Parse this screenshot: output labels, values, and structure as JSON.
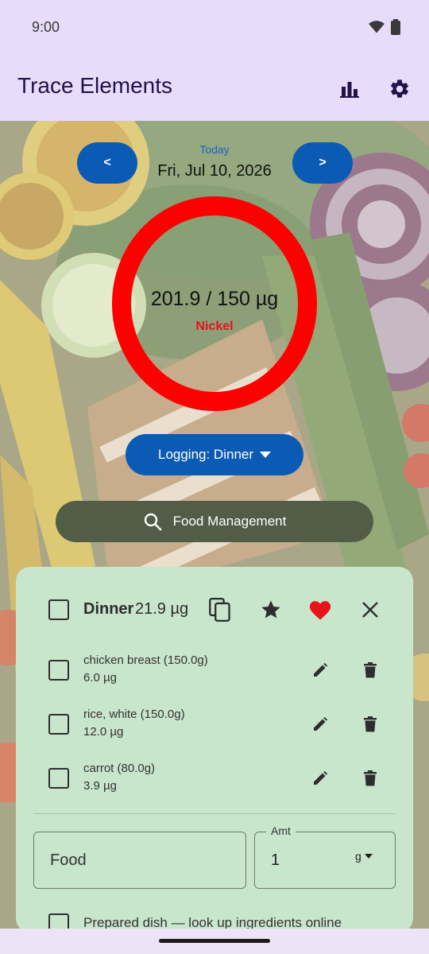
{
  "status": {
    "time": "9:00"
  },
  "app": {
    "title": "Trace Elements",
    "chart_icon": "bar-chart-icon",
    "settings_icon": "gear-icon"
  },
  "date_nav": {
    "prev_label": "<",
    "next_label": ">",
    "today_label": "Today",
    "date": "Fri, Jul 10, 2026"
  },
  "summary": {
    "value_text": "201.9 / 150 µg",
    "element": "Nickel",
    "ring_color": "#ff0000",
    "progress": 1.346
  },
  "logging": {
    "label": "Logging: Dinner"
  },
  "food_management": {
    "label": "Food Management"
  },
  "meal": {
    "title": "Dinner",
    "amount": "21.9 µg",
    "items": [
      {
        "name": "chicken breast (150.0g)",
        "value": "6.0 µg"
      },
      {
        "name": "rice, white (150.0g)",
        "value": "12.0 µg"
      },
      {
        "name": "carrot (80.0g)",
        "value": "3.9 µg"
      }
    ]
  },
  "form": {
    "food_placeholder": "Food",
    "amt_label": "Amt",
    "amt_value": "1",
    "amt_unit": "g",
    "prepared_label": "Prepared dish — look up ingredients online"
  },
  "colors": {
    "primary": "#0b5bb5",
    "appbar": "#e8dcfb",
    "card": "#c8e6cb",
    "heart": "#e8141a",
    "food_btn": "#525d47"
  }
}
